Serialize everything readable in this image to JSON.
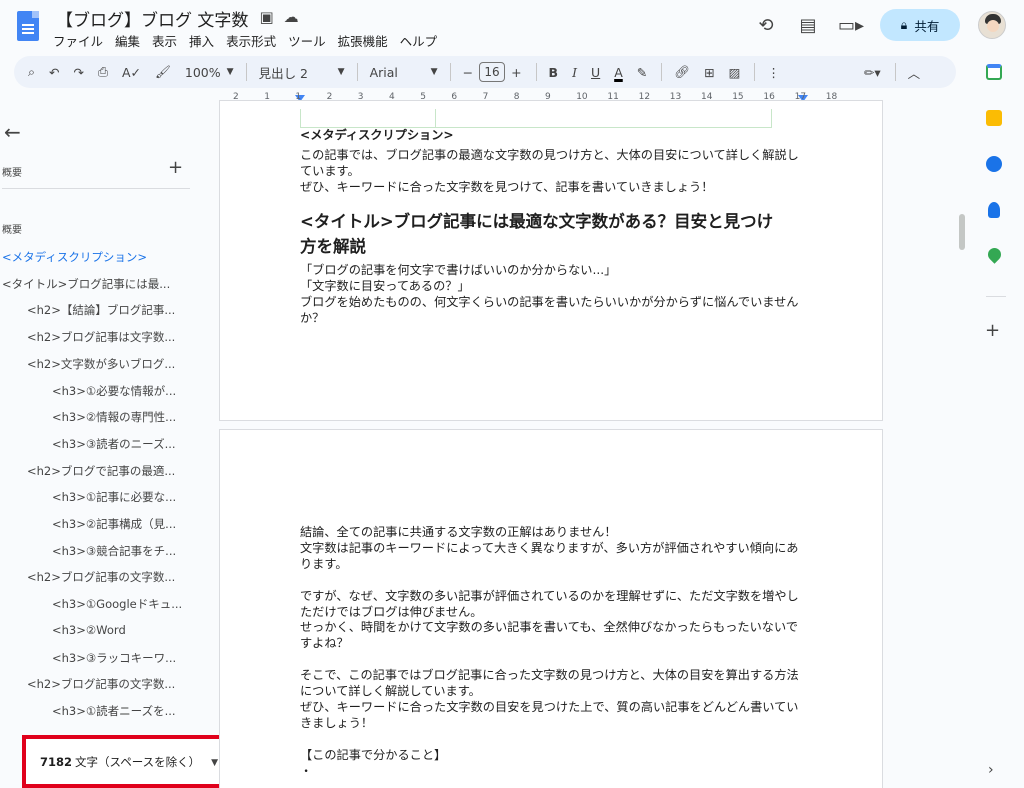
{
  "header": {
    "title": "【ブログ】ブログ 文字数",
    "menu": [
      "ファイル",
      "編集",
      "表示",
      "挿入",
      "表示形式",
      "ツール",
      "拡張機能",
      "ヘルプ"
    ],
    "share_label": "共有",
    "icons": [
      "history-icon",
      "comment-icon",
      "meet-icon"
    ]
  },
  "toolbar": {
    "zoom": "100%",
    "style": "見出し 2",
    "font": "Arial",
    "font_size": "16",
    "minus": "−",
    "plus": "+",
    "bold": "B",
    "italic": "I",
    "underline": "U",
    "text_color": "A"
  },
  "ruler": {
    "numbers": [
      "2",
      "1",
      "1",
      "2",
      "3",
      "4",
      "5",
      "6",
      "7",
      "8",
      "9",
      "10",
      "11",
      "12",
      "13",
      "14",
      "15",
      "16",
      "17",
      "18"
    ]
  },
  "sidebar": {
    "summary_label": "概要",
    "outline_label": "概要",
    "items": [
      {
        "text": "<メタディスクリプション>",
        "level": 1,
        "active": true
      },
      {
        "text": "<タイトル>ブログ記事には最...",
        "level": 1,
        "active": false
      },
      {
        "text": "<h2>【結論】ブログ記事...",
        "level": 2,
        "active": false
      },
      {
        "text": "<h2>ブログ記事は文字数...",
        "level": 2,
        "active": false
      },
      {
        "text": "<h2>文字数が多いブログ...",
        "level": 2,
        "active": false
      },
      {
        "text": "<h3>①必要な情報が...",
        "level": 3,
        "active": false
      },
      {
        "text": "<h3>②情報の専門性...",
        "level": 3,
        "active": false
      },
      {
        "text": "<h3>③読者のニーズ...",
        "level": 3,
        "active": false
      },
      {
        "text": "<h2>ブログで記事の最適...",
        "level": 2,
        "active": false
      },
      {
        "text": "<h3>①記事に必要な...",
        "level": 3,
        "active": false
      },
      {
        "text": "<h3>②記事構成（見...",
        "level": 3,
        "active": false
      },
      {
        "text": "<h3>③競合記事をチ...",
        "level": 3,
        "active": false
      },
      {
        "text": "<h2>ブログ記事の文字数...",
        "level": 2,
        "active": false
      },
      {
        "text": "<h3>①Googleドキュ...",
        "level": 3,
        "active": false
      },
      {
        "text": "<h3>②Word",
        "level": 3,
        "active": false
      },
      {
        "text": "<h3>③ラッコキーワ...",
        "level": 3,
        "active": false
      },
      {
        "text": "<h2>ブログ記事の文字数...",
        "level": 2,
        "active": false
      },
      {
        "text": "<h3>①読者ニーズを...",
        "level": 3,
        "active": false
      }
    ]
  },
  "word_count": {
    "count": "7182",
    "label": "文字（スペースを除く）"
  },
  "page1": {
    "meta_heading": "<メタディスクリプション>",
    "meta_line1": "この記事では、ブログ記事の最適な文字数の見つけ方と、大体の目安について詳しく解説し",
    "meta_line2": "ています。",
    "meta_line3": "ぜひ、キーワードに合った文字数を見つけて、記事を書いていきましょう！",
    "title_line1": "<タイトル>ブログ記事には最適な文字数がある？目安と見つけ",
    "title_line2": "方を解説",
    "body_line1": "「ブログの記事を何文字で書けばいいのか分からない...」",
    "body_line2": "「文字数に目安ってあるの？」",
    "body_line3": "ブログを始めたものの、何文字くらいの記事を書いたらいいかが分からずに悩んでいません",
    "body_line4": "か？"
  },
  "page2": {
    "lines": [
      "結論、全ての記事に共通する文字数の正解はありません！",
      "文字数は記事のキーワードによって大きく異なりますが、多い方が評価されやすい傾向にあ",
      "ります。",
      "",
      "ですが、なぜ、文字数の多い記事が評価されているのかを理解せずに、ただ文字数を増やし",
      "ただけではブログは伸びません。",
      "せっかく、時間をかけて文字数の多い記事を書いても、全然伸びなかったらもったいないで",
      "すよね？",
      "",
      "そこで、この記事ではブログ記事に合った文字数の見つけ方と、大体の目安を算出する方法",
      "について詳しく解説しています。",
      "ぜひ、キーワードに合った文字数の目安を見つけた上で、質の高い記事をどんどん書いてい",
      "きましょう！",
      "",
      "【この記事で分かること】",
      "・"
    ]
  },
  "colors": {
    "accent": "#1a73e8",
    "highlight_border": "#e0001b",
    "share_bg": "#c2e7ff"
  }
}
